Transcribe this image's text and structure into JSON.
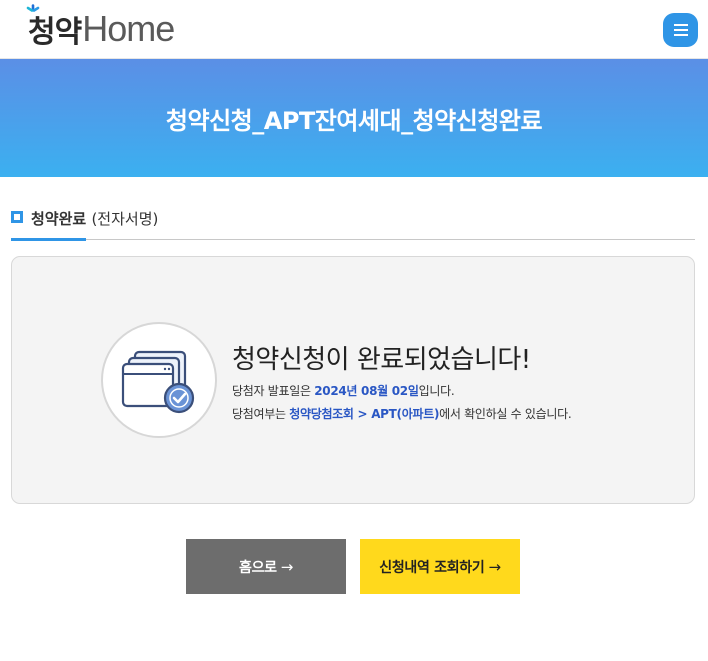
{
  "header": {
    "logo": {
      "korean": "청약",
      "latin": "Home"
    },
    "menu_icon": "hamburger-icon"
  },
  "banner": {
    "title": "청약신청_APT잔여세대_청약신청완료"
  },
  "section": {
    "title": "청약완료",
    "subtitle": "(전자서명)"
  },
  "result": {
    "icon": "browser-windows-check-icon",
    "heading": "청약신청이 완료되었습니다!",
    "line1_prefix": "당첨자 발표일은 ",
    "announcement_date": "2024년 08월 02일",
    "line1_suffix": "입니다.",
    "line2_prefix": "당첨여부는 ",
    "link_primary": "청약당첨조회",
    "link_separator": " > ",
    "link_secondary": "APT(아파트)",
    "line2_suffix": "에서 확인하실 수 있습니다."
  },
  "buttons": {
    "home_label": "홈으로",
    "check_label": "신청내역 조회하기",
    "arrow": "→"
  },
  "colors": {
    "accent": "#2f95e6",
    "banner_start": "#5b8fe6",
    "banner_end": "#3bb0f0",
    "highlight": "#2a57c4",
    "home_button": "#6d6d6d",
    "check_button": "#ffd91c"
  }
}
